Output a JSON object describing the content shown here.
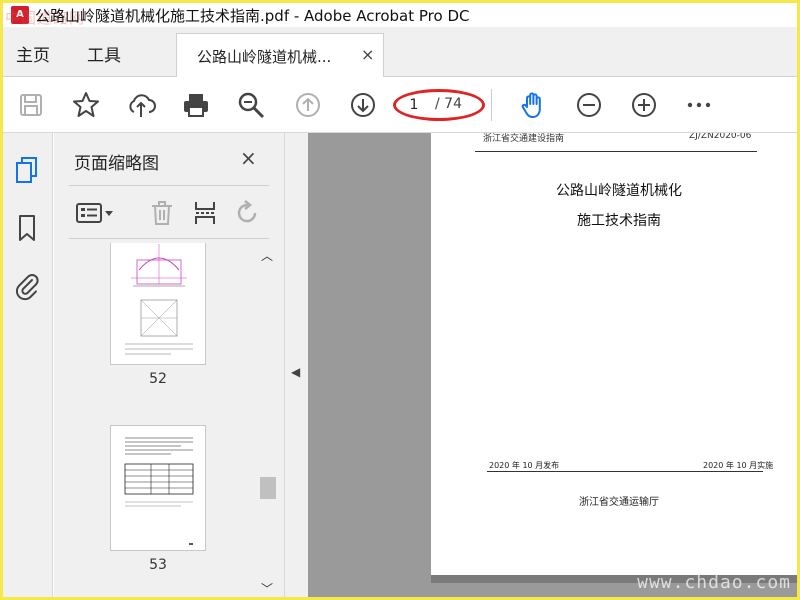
{
  "titlebar": {
    "title": "公路山岭隧道机械化施工技术指南.pdf - Adobe Acrobat Pro DC",
    "watermark_top": "中国道路网"
  },
  "tabs": {
    "home": "主页",
    "tools": "工具",
    "document": "公路山岭隧道机械...",
    "close": "×"
  },
  "toolbar": {
    "icons": [
      "save-icon",
      "bookmark-star-icon",
      "upload-cloud-icon",
      "print-icon",
      "zoom-search-icon",
      "page-up-icon",
      "page-down-icon",
      "hand-tool-icon",
      "zoom-out-icon",
      "zoom-in-icon",
      "more-icon"
    ],
    "page_current": "1",
    "page_total": "/ 74",
    "accent_color": "#1473e6",
    "highlight_color": "#e02424"
  },
  "panel": {
    "title": "页面缩略图",
    "close": "×",
    "thumbnails": [
      {
        "label": "52"
      },
      {
        "label": "53"
      }
    ]
  },
  "document": {
    "header_left": "浙江省交通建设指南",
    "header_right": "ZJ/ZN2020-06",
    "title_line1": "公路山岭隧道机械化",
    "title_line2": "施工技术指南",
    "issue_date": "2020 年 10 月发布",
    "implement_date": "2020 年 10 月实施",
    "organization": "浙江省交通运输厅"
  },
  "watermark_bottom": "www.chdao.com"
}
